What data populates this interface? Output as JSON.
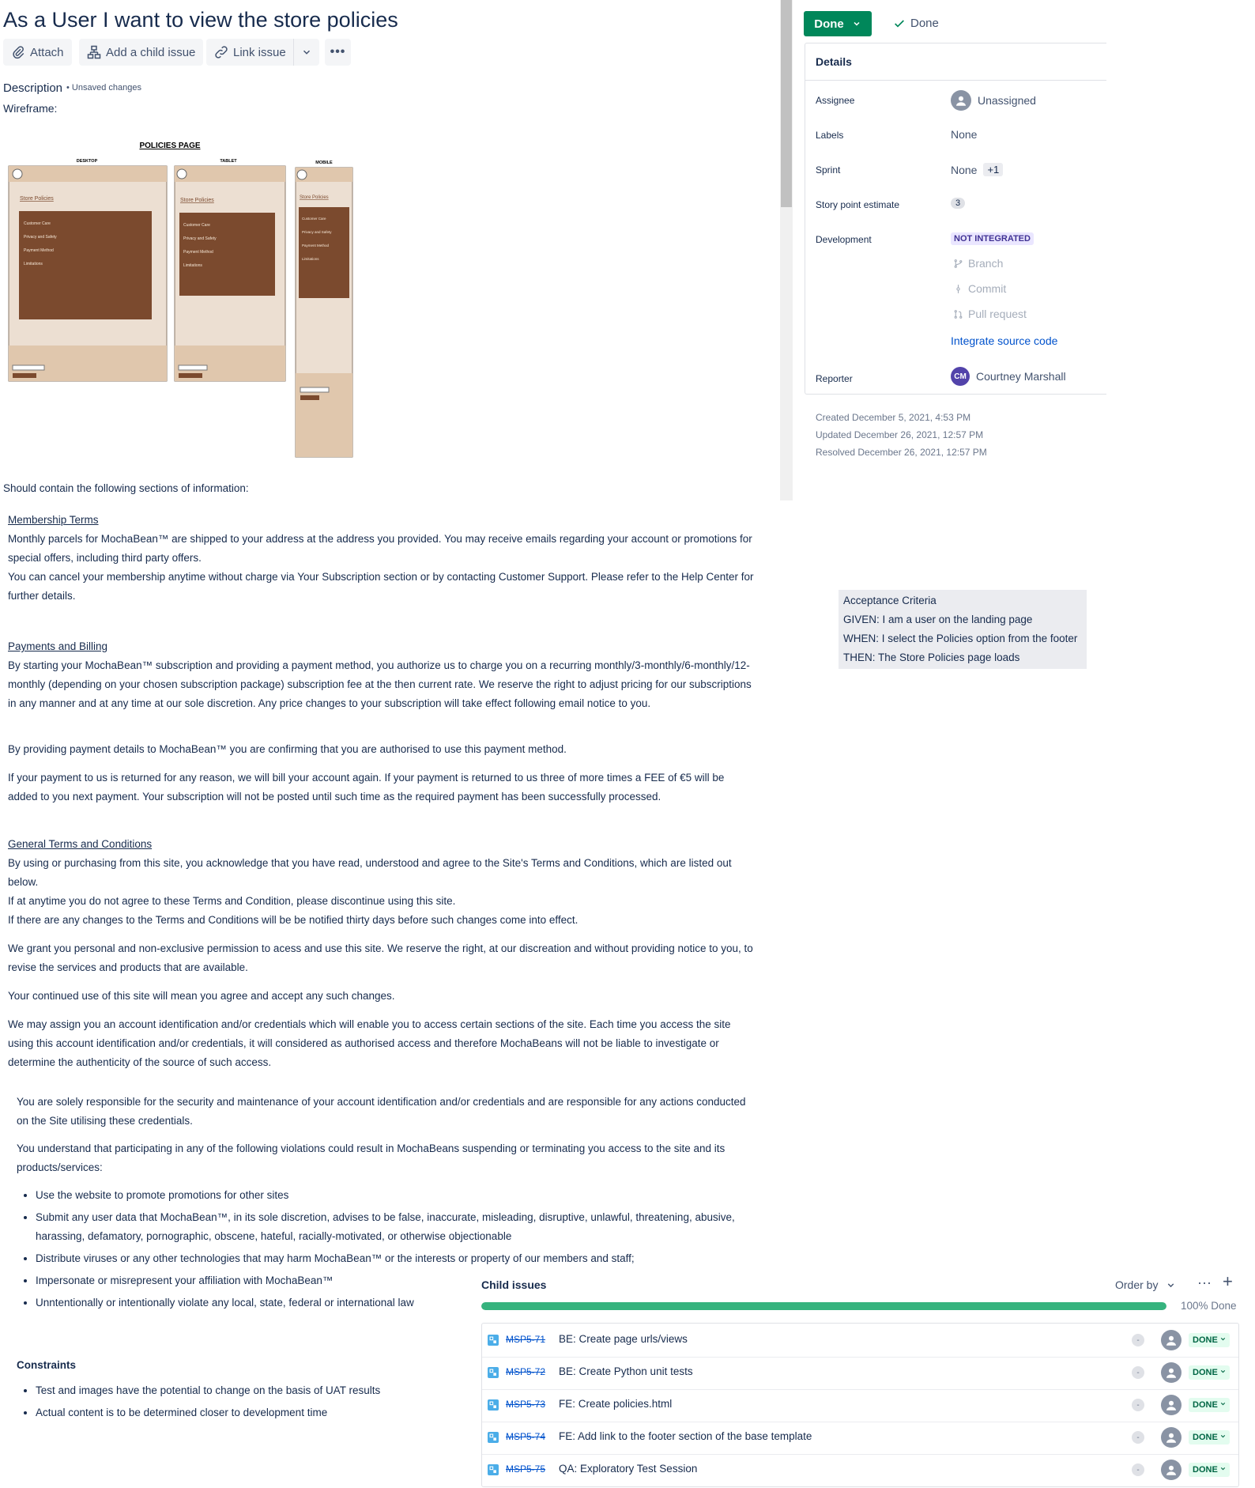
{
  "title": "As a User I want to view the store policies",
  "toolbar": {
    "attach": "Attach",
    "add_child": "Add a child issue",
    "link_issue": "Link issue"
  },
  "description": {
    "label": "Description",
    "unsaved": "• Unsaved changes",
    "wireframe_label": "Wireframe:"
  },
  "wireframe": {
    "heading": "POLICIES PAGE",
    "desktop": "DESKTOP",
    "tablet": "TABLET",
    "mobile": "MOBILE",
    "store_policies": "Store Policies",
    "items": [
      "Customer Care",
      "Privacy and Safety",
      "Payment Method",
      "Limitations"
    ]
  },
  "intro": "Should contain the following sections of information:",
  "membership": {
    "heading": "Membership Terms",
    "p1": "Monthly parcels for MochaBean™ are shipped to your address at the address you provided. You may receive emails regarding your account or promotions for special offers, including third party offers.",
    "p2": "You can cancel your membership anytime without charge via Your Subscription section or by contacting Customer Support. Please refer to the Help Center for further details."
  },
  "payments": {
    "heading": "Payments and Billing",
    "p1": "By starting your MochaBean™ subscription and providing a payment method, you authorize us to charge you on a recurring monthly/3-monthly/6-monthly/12-monthly (depending on your chosen subscription package) subscription fee at the then current rate. We reserve the right to adjust pricing for our subscriptions in any manner and at any time at our sole discretion. Any price changes to your subscription will take effect following email notice to you.",
    "p2": "By providing payment details to MochaBean™ you are confirming that you are authorised to use this payment method.",
    "p3": "If your payment to us is returned for any reason, we will bill your account again. If your payment is returned to us three of more times a FEE of €5 will be added to you next payment. Your subscription will not be posted until such time as the required payment has been successfully processed."
  },
  "general": {
    "heading": "General Terms and Conditions",
    "p1": "By using or purchasing from this site, you acknowledge that you have read, understood and agree to the Site's Terms and Conditions, which are listed out below.",
    "p2": "If at anytime you do not agree to these Terms and Condition, please discontinue using this site.",
    "p3": "If there are any changes to the Terms and Conditions will be be notified thirty days before such changes come into effect.",
    "p4": "We grant you personal and non-exclusive permission to acess and use this site. We reserve the right, at our discreation and without providing notice to you, to revise the services and products that are available.",
    "p5": "Your continued use of this site will mean you agree and accept any such changes.",
    "p6": "We may assign you an account identification and/or credentials which will enable you to access certain sections of the site. Each time you access the site using this account identification and/or credentials, it will considered as authorised access and therefore MochaBeans will not be liable to investigate or determine the authenticity of the source of such access.",
    "p7": "You are solely responsible for the security and maintenance of your account identification and/or credentials and are responsible for any actions conducted on the Site utilising these credentials.",
    "p8": "You understand that participating in any of the following violations could result in MochaBeans suspending or terminating you access to the site and its products/services:",
    "bullets": [
      "Use the website to promote promotions for other sites",
      "Submit any user data that MochaBean™, in its sole discretion, advises to be false, inaccurate, misleading, disruptive, unlawful, threatening, abusive, harassing, defamatory, pornographic, obscene, hateful, racially-motivated, or otherwise objectionable",
      "Distribute viruses or any other technologies that may harm MochaBean™ or the interests or property of our members and staff;",
      "Impersonate or misrepresent your affiliation with MochaBean™",
      "Unntentionally or intentionally violate any local, state, federal or international law"
    ]
  },
  "constraints": {
    "heading": "Constraints",
    "bullets": [
      "Test and images have the potential to change on the basis of UAT results",
      "Actual content is to be determined closer to development time"
    ]
  },
  "status": {
    "button": "Done",
    "resolution": "Done"
  },
  "details": {
    "title": "Details",
    "assignee_label": "Assignee",
    "assignee_value": "Unassigned",
    "labels_label": "Labels",
    "labels_value": "None",
    "sprint_label": "Sprint",
    "sprint_value": "None",
    "sprint_extra": "+1",
    "estimate_label": "Story point estimate",
    "estimate_value": "3",
    "development_label": "Development",
    "development_status": "NOT INTEGRATED",
    "branch": "Branch",
    "commit": "Commit",
    "pull_request": "Pull request",
    "integrate": "Integrate source code",
    "reporter_label": "Reporter",
    "reporter_initials": "CM",
    "reporter_value": "Courtney Marshall"
  },
  "meta": {
    "created": "Created December 5, 2021, 4:53 PM",
    "updated": "Updated December 26, 2021, 12:57 PM",
    "resolved": "Resolved December 26, 2021, 12:57 PM"
  },
  "acceptance": {
    "title": "Acceptance Criteria",
    "given": "GIVEN: I am a user on the landing page",
    "when": "WHEN: I select the Policies option from the footer",
    "then": "THEN: The Store Policies page loads"
  },
  "child_issues": {
    "title": "Child issues",
    "order_by": "Order by",
    "progress_fraction": 1.0,
    "progress_label": "100% Done",
    "items": [
      {
        "key": "MSP5-71",
        "summary": "BE: Create page urls/views",
        "status": "DONE"
      },
      {
        "key": "MSP5-72",
        "summary": "BE: Create Python unit tests",
        "status": "DONE"
      },
      {
        "key": "MSP5-73",
        "summary": "FE: Create policies.html",
        "status": "DONE"
      },
      {
        "key": "MSP5-74",
        "summary": "FE: Add link to the footer section of the base template",
        "status": "DONE"
      },
      {
        "key": "MSP5-75",
        "summary": "QA: Exploratory Test Session",
        "status": "DONE"
      }
    ]
  },
  "colors": {
    "done_green": "#00875a",
    "progress_green": "#36b37e",
    "link_blue": "#0052cc"
  }
}
